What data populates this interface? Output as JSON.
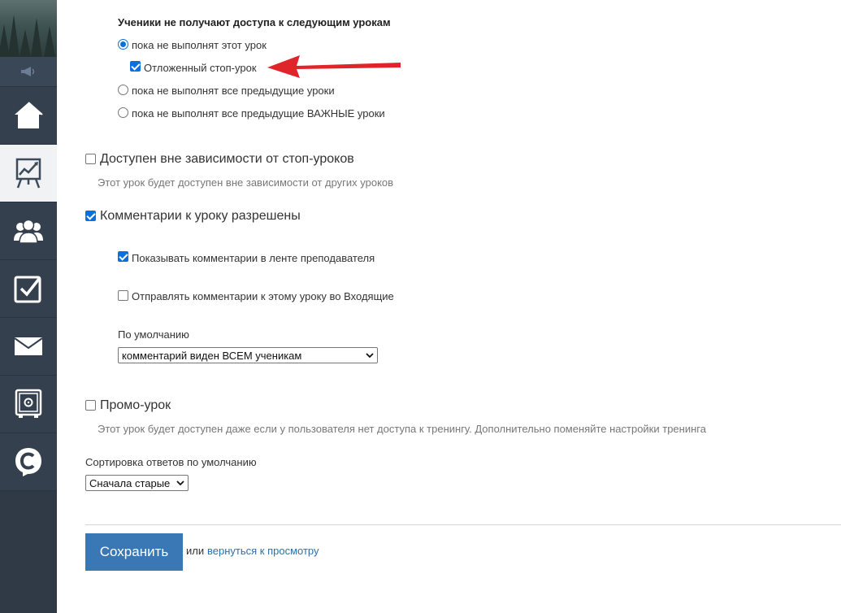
{
  "sidebar": {
    "items": [
      {
        "name": "home",
        "icon": "home-icon"
      },
      {
        "name": "trainings",
        "icon": "chart-board-icon",
        "active": true
      },
      {
        "name": "users",
        "icon": "users-icon"
      },
      {
        "name": "tasks",
        "icon": "checkbox-icon"
      },
      {
        "name": "messages",
        "icon": "envelope-icon"
      },
      {
        "name": "safe",
        "icon": "safe-icon"
      },
      {
        "name": "getcourse",
        "icon": "chat-logo-icon"
      }
    ],
    "colors": {
      "bg": "#34404e",
      "active_bg": "#f1f2f3"
    }
  },
  "access": {
    "heading": "Ученики не получают доступа к следующим урокам",
    "options": [
      {
        "label": "пока не выполнят этот урок",
        "selected": true
      },
      {
        "label": "пока не выполнят все предыдущие уроки",
        "selected": false
      },
      {
        "label": "пока не выполнят все предыдущие ВАЖНЫЕ уроки",
        "selected": false
      }
    ],
    "delayed_stop": {
      "label": "Отложенный стоп-урок",
      "checked": true
    }
  },
  "independent": {
    "label": "Доступен вне зависимости от стоп-уроков",
    "checked": false,
    "hint": "Этот урок будет доступен вне зависимости от других уроков"
  },
  "comments": {
    "label": "Комментарии к уроку разрешены",
    "checked": true,
    "show_in_feed": {
      "label": "Показывать комментарии в ленте преподавателя",
      "checked": true
    },
    "send_to_inbox": {
      "label": "Отправлять комментарии к этому уроку во Входящие",
      "checked": false
    },
    "default_label": "По умолчанию",
    "default_value": "комментарий виден ВСЕМ ученикам"
  },
  "promo": {
    "label": "Промо-урок",
    "checked": false,
    "hint": "Этот урок будет доступен даже если у пользователя нет доступа к тренингу. Дополнительно поменяйте настройки тренинга"
  },
  "sorting": {
    "label": "Сортировка ответов по умолчанию",
    "value": "Сначала старые"
  },
  "actions": {
    "save_label": "Сохранить",
    "or_text": "или",
    "back_link": "вернуться к просмотру"
  },
  "colors": {
    "accent": "#3a78b5",
    "annotation_arrow": "#e0252a",
    "link": "#2f6fa8"
  }
}
